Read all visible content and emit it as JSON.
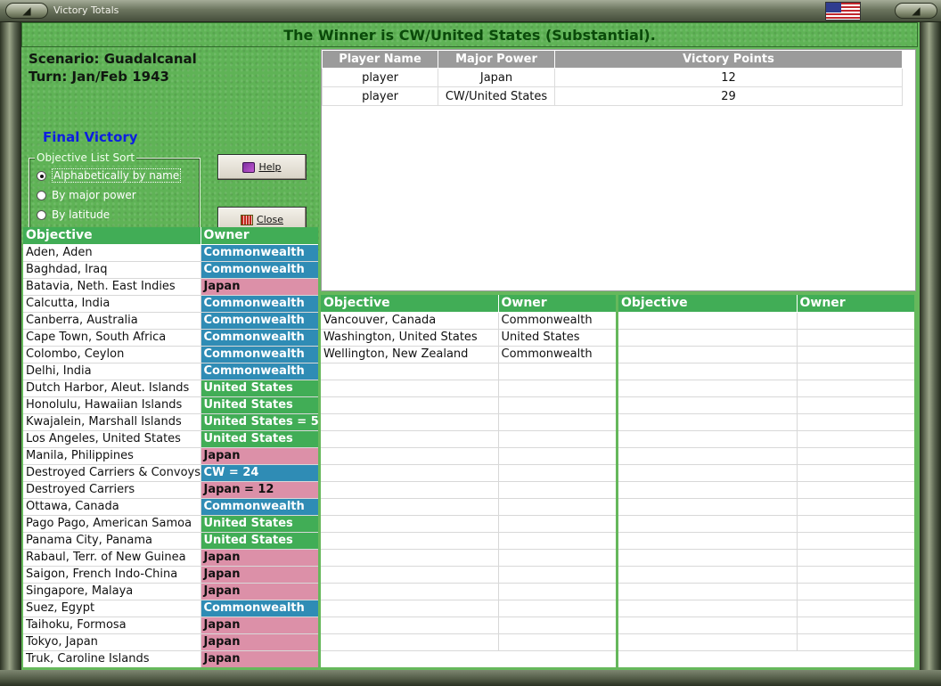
{
  "window": {
    "title": "Victory Totals"
  },
  "winner_text": "The Winner is  CW/United States (Substantial).",
  "scenario": "Scenario: Guadalcanal",
  "turn": "Turn: Jan/Feb 1943",
  "final_victory": "Final Victory",
  "sort": {
    "legend": "Objective List Sort",
    "options": [
      "Alphabetically by name",
      "By major power",
      "By latitude"
    ],
    "selected_index": 0
  },
  "buttons": {
    "help": "Help",
    "close": "Close"
  },
  "players": {
    "headers": [
      "Player Name",
      "Major Power",
      "Victory Points"
    ],
    "rows": [
      {
        "name": "player",
        "power": "Japan",
        "points": "12"
      },
      {
        "name": "player",
        "power": "CW/United States",
        "points": "29"
      }
    ]
  },
  "objective_headers": {
    "objective": "Objective",
    "owner": "Owner"
  },
  "owner_colors": {
    "cw": "#2f8cb5",
    "us": "#41ad56",
    "jp": "#dc90a8"
  },
  "main_objectives": [
    {
      "objective": "Aden, Aden",
      "owner": "Commonwealth",
      "side": "cw"
    },
    {
      "objective": "Baghdad, Iraq",
      "owner": "Commonwealth",
      "side": "cw"
    },
    {
      "objective": "Batavia, Neth. East Indies",
      "owner": "Japan",
      "side": "jp"
    },
    {
      "objective": "Calcutta, India",
      "owner": "Commonwealth",
      "side": "cw"
    },
    {
      "objective": "Canberra, Australia",
      "owner": "Commonwealth",
      "side": "cw"
    },
    {
      "objective": "Cape Town, South Africa",
      "owner": "Commonwealth",
      "side": "cw"
    },
    {
      "objective": "Colombo, Ceylon",
      "owner": "Commonwealth",
      "side": "cw"
    },
    {
      "objective": "Delhi, India",
      "owner": "Commonwealth",
      "side": "cw"
    },
    {
      "objective": "Dutch Harbor, Aleut. Islands",
      "owner": "United States",
      "side": "us"
    },
    {
      "objective": "Honolulu, Hawaiian Islands",
      "owner": "United States",
      "side": "us"
    },
    {
      "objective": "Kwajalein, Marshall Islands",
      "owner": "United States = 5",
      "side": "us"
    },
    {
      "objective": "Los Angeles, United States",
      "owner": "United States",
      "side": "us"
    },
    {
      "objective": "Manila, Philippines",
      "owner": "Japan",
      "side": "jp"
    },
    {
      "objective": "Destroyed Carriers & Convoys",
      "owner": "CW = 24",
      "side": "cw"
    },
    {
      "objective": "Destroyed Carriers",
      "owner": "Japan = 12",
      "side": "jp"
    },
    {
      "objective": "Ottawa, Canada",
      "owner": "Commonwealth",
      "side": "cw"
    },
    {
      "objective": "Pago Pago, American Samoa",
      "owner": "United States",
      "side": "us"
    },
    {
      "objective": "Panama City, Panama",
      "owner": "United States",
      "side": "us"
    },
    {
      "objective": "Rabaul, Terr. of New Guinea",
      "owner": "Japan",
      "side": "jp"
    },
    {
      "objective": "Saigon, French Indo-China",
      "owner": "Japan",
      "side": "jp"
    },
    {
      "objective": "Singapore, Malaya",
      "owner": "Japan",
      "side": "jp"
    },
    {
      "objective": "Suez, Egypt",
      "owner": "Commonwealth",
      "side": "cw"
    },
    {
      "objective": "Taihoku, Formosa",
      "owner": "Japan",
      "side": "jp"
    },
    {
      "objective": "Tokyo, Japan",
      "owner": "Japan",
      "side": "jp"
    },
    {
      "objective": "Truk, Caroline Islands",
      "owner": "Japan",
      "side": "jp"
    }
  ],
  "mid_objectives": [
    {
      "objective": "Vancouver, Canada",
      "owner": "Commonwealth"
    },
    {
      "objective": "Washington, United States",
      "owner": "United States"
    },
    {
      "objective": "Wellington, New Zealand",
      "owner": "Commonwealth"
    }
  ],
  "right_objectives": []
}
